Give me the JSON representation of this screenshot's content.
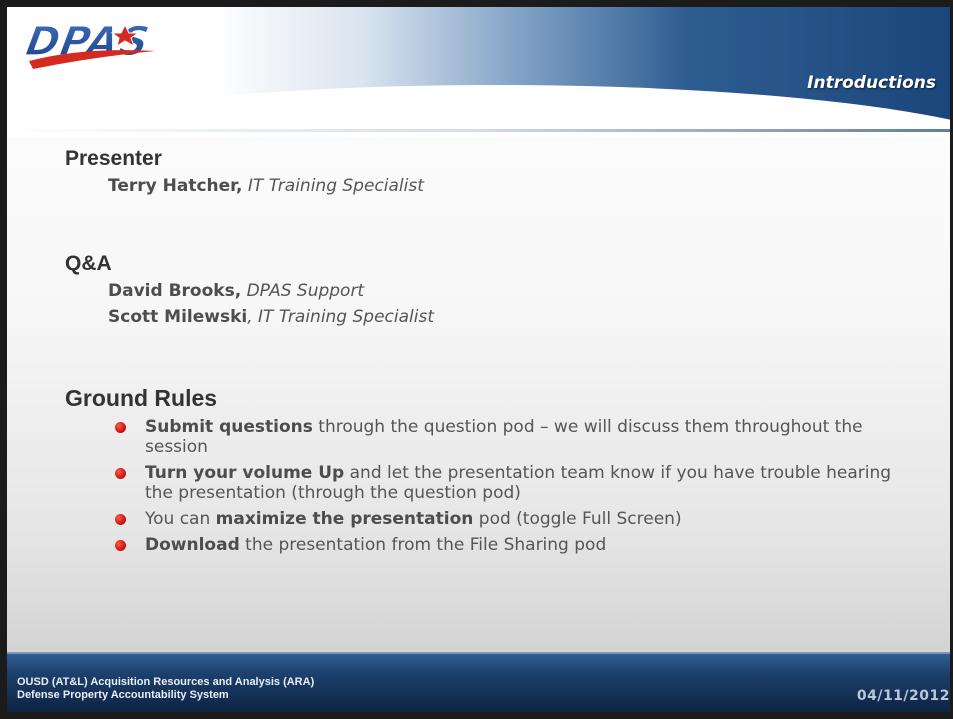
{
  "header": {
    "logo_text": "DPAS",
    "section_title": "Introductions"
  },
  "presenter": {
    "heading": "Presenter",
    "people": [
      {
        "name": "Terry Hatcher,",
        "role": "IT Training Specialist"
      }
    ]
  },
  "qa": {
    "heading": "Q&A",
    "people": [
      {
        "name": "David Brooks,",
        "role": "DPAS Support"
      },
      {
        "name": "Scott Milewski",
        "role": ", IT Training Specialist"
      }
    ]
  },
  "ground_rules": {
    "heading": "Ground Rules",
    "items": [
      {
        "bold": "Submit questions",
        "text": " through the question pod – we will discuss them throughout the session"
      },
      {
        "bold": "Turn your volume Up",
        "text": " and let the presentation team know if you have trouble hearing the presentation (through the question pod)"
      },
      {
        "pre": "You can ",
        "bold": "maximize the presentation",
        "text": " pod (toggle Full Screen)"
      },
      {
        "bold": "Download",
        "text": " the presentation from the File Sharing pod"
      }
    ]
  },
  "footer": {
    "line1": "OUSD (AT&L) Acquisition Resources and Analysis (ARA)",
    "line2": "Defense Property Accountability System",
    "date": "04/11/2012"
  },
  "colors": {
    "header_blue": "#1b467c",
    "bullet_red": "#d41a12",
    "logo_blue": "#2b56a0",
    "logo_red": "#d62a20"
  }
}
